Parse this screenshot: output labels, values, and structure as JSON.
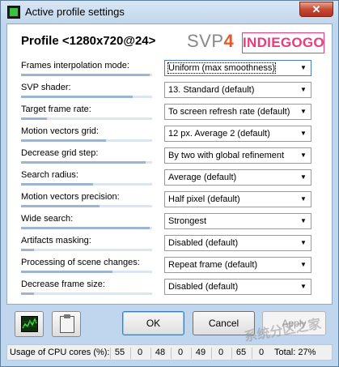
{
  "window": {
    "title": "Active profile settings",
    "close_glyph": "✕"
  },
  "header": {
    "profile_title": "Profile <1280x720@24>",
    "logo_svp": "SVP",
    "logo_num": "4",
    "logo_indiegogo": "INDIEGOGO"
  },
  "settings": [
    {
      "label": "Frames interpolation mode:",
      "value": "Uniform (max smoothness)",
      "level": 0.98
    },
    {
      "label": "SVP shader:",
      "value": "13. Standard (default)",
      "level": 0.85
    },
    {
      "label": "Target frame rate:",
      "value": "To screen refresh rate (default)",
      "level": 0.2
    },
    {
      "label": "Motion vectors grid:",
      "value": "12 px. Average 2 (default)",
      "level": 0.65
    },
    {
      "label": "Decrease grid step:",
      "value": "By two with global refinement",
      "level": 0.95
    },
    {
      "label": "Search radius:",
      "value": "Average (default)",
      "level": 0.55
    },
    {
      "label": "Motion vectors precision:",
      "value": "Half pixel (default)",
      "level": 0.6
    },
    {
      "label": "Wide search:",
      "value": "Strongest",
      "level": 0.98
    },
    {
      "label": "Artifacts masking:",
      "value": "Disabled (default)",
      "level": 0.1
    },
    {
      "label": "Processing of scene changes:",
      "value": "Repeat frame (default)",
      "level": 0.7
    },
    {
      "label": "Decrease frame size:",
      "value": "Disabled (default)",
      "level": 0.1
    }
  ],
  "buttons": {
    "ok": "OK",
    "cancel": "Cancel",
    "apply": "Apply"
  },
  "icons": {
    "graph": "cpu-graph-icon",
    "clipboard": "clipboard-icon"
  },
  "status": {
    "label": "Usage of CPU cores (%):",
    "cores": [
      "55",
      "0",
      "48",
      "0",
      "49",
      "0",
      "65",
      "0"
    ],
    "total": "Total: 27%"
  },
  "watermark": "系统分区之家"
}
